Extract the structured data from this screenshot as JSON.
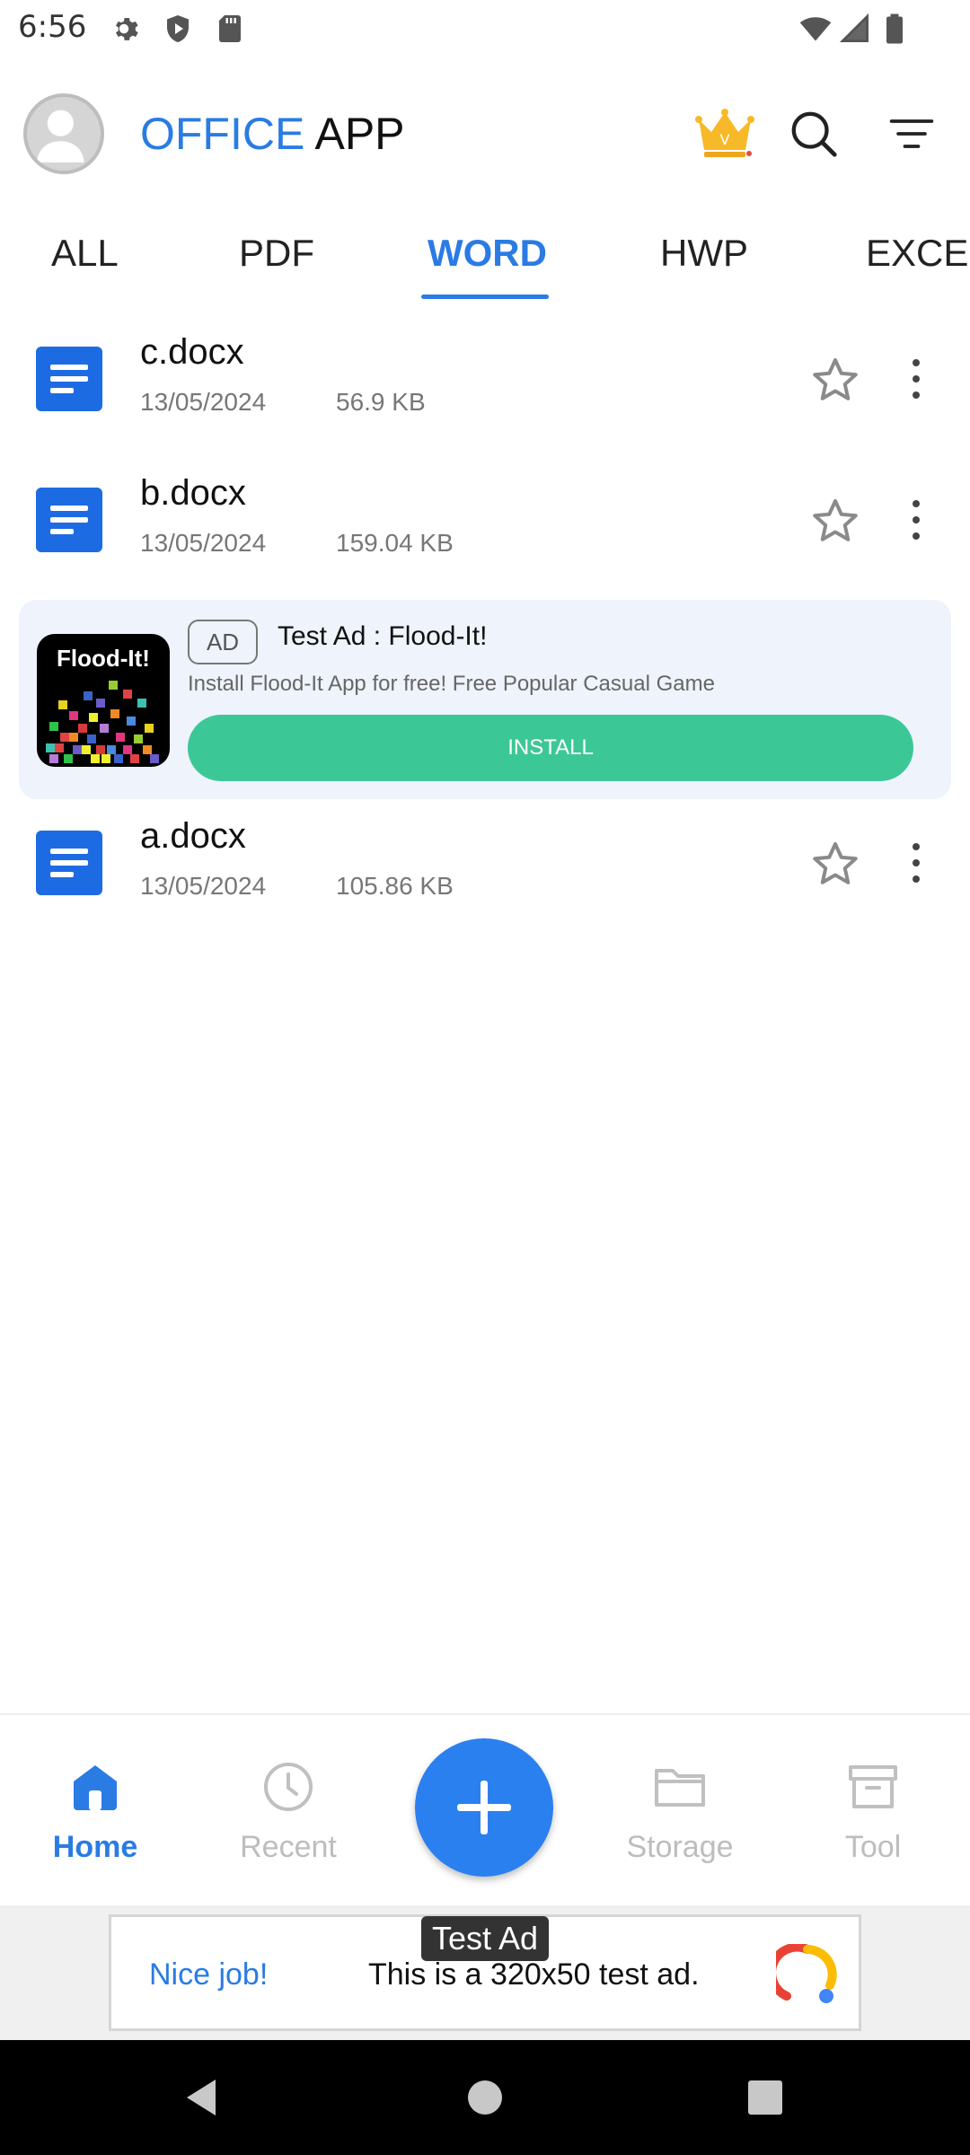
{
  "status_bar": {
    "time": "6:56",
    "icons": [
      "gear-icon",
      "shield-play-icon",
      "sd-card-icon",
      "wifi-icon",
      "signal-icon",
      "battery-icon"
    ]
  },
  "header": {
    "title_part1": "OFFICE",
    "title_part2": "APP",
    "icons": [
      "premium-crown-icon",
      "search-icon",
      "filter-icon"
    ],
    "crown_letter": "V"
  },
  "tabs": [
    {
      "label": "ALL",
      "active": false
    },
    {
      "label": "PDF",
      "active": false
    },
    {
      "label": "WORD",
      "active": true
    },
    {
      "label": "HWP",
      "active": false
    },
    {
      "label": "EXCEL",
      "active": false
    }
  ],
  "files": [
    {
      "name": "c.docx",
      "date": "13/05/2024",
      "size": "56.9 KB"
    },
    {
      "name": "b.docx",
      "date": "13/05/2024",
      "size": "159.04 KB"
    },
    {
      "name": "a.docx",
      "date": "13/05/2024",
      "size": "105.86 KB"
    }
  ],
  "ad_card": {
    "badge": "AD",
    "title": "Test Ad : Flood-It!",
    "description": "Install Flood-It App for free! Free Popular Casual Game",
    "button": "INSTALL",
    "app_image_title": "Flood-It!"
  },
  "bottom_nav": {
    "items": [
      {
        "label": "Home",
        "icon": "home-icon",
        "active": true
      },
      {
        "label": "Recent",
        "icon": "clock-icon",
        "active": false
      },
      {
        "label": "Storage",
        "icon": "folder-icon",
        "active": false
      },
      {
        "label": "Tool",
        "icon": "archive-box-icon",
        "active": false
      }
    ],
    "fab_icon": "plus-icon"
  },
  "banner_ad": {
    "tag": "Test Ad",
    "nice": "Nice job!",
    "text": "This is a 320x50 test ad."
  },
  "colors": {
    "accent": "#2a7be4",
    "install_green": "#3cc796",
    "doc_blue": "#1d6be3",
    "ad_background": "#eef3fc"
  }
}
